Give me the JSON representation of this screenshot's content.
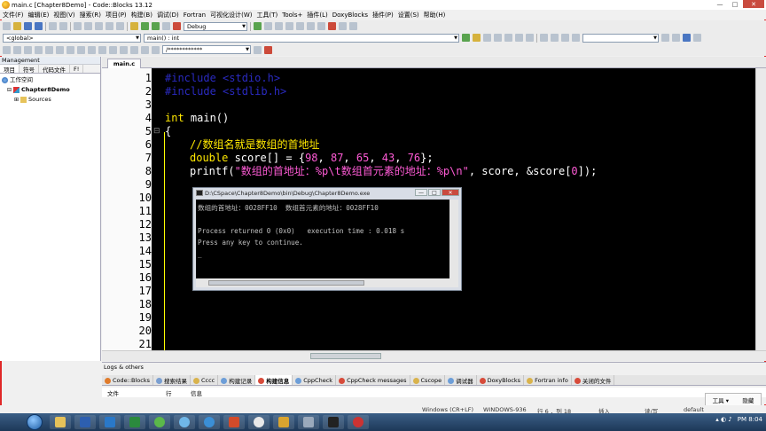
{
  "window": {
    "title": "main.c [Chapter8Demo] - Code::Blocks 13.12"
  },
  "menu": [
    "文件(F)",
    "编辑(E)",
    "视图(V)",
    "搜索(R)",
    "项目(P)",
    "构建(B)",
    "调试(D)",
    "Fortran",
    "可视化设计(W)",
    "工具(T)",
    "Tools+",
    "插件(L)",
    "DoxyBlocks",
    "插件(P)",
    "设置(S)",
    "帮助(H)"
  ],
  "toolbar": {
    "build_target": "Debug",
    "scope": "<global>",
    "function": "main() : int",
    "search_text": "/************"
  },
  "management": {
    "title": "Management",
    "tabs": [
      "项目",
      "符号",
      "代码文件",
      "F!"
    ],
    "workspace": "工作空间",
    "project": "Chapter8Demo",
    "folder": "Sources"
  },
  "editor": {
    "tab": "main.c",
    "line_numbers": [
      "1",
      "2",
      "3",
      "4",
      "5",
      "6",
      "7",
      "8",
      "9",
      "10",
      "11",
      "12",
      "13",
      "14",
      "15",
      "16",
      "17",
      "18",
      "19",
      "20",
      "21"
    ],
    "code": {
      "l1": "#include <stdio.h>",
      "l2": "#include <stdlib.h>",
      "l4_kw": "int",
      "l4_rest": " main()",
      "l5": "{",
      "l6": "//数组名就是数组的首地址",
      "l7_kw": "double",
      "l7_a": " score[] = {",
      "l7_n1": "98",
      "l7_n2": "87",
      "l7_n3": "65",
      "l7_n4": "43",
      "l7_n5": "76",
      "l7_end": "};",
      "l8_a": "printf(",
      "l8_str": "\"数组的首地址：%p\\t数组首元素的地址：%p\\n\"",
      "l8_b": ", score, &score[",
      "l8_n": "0",
      "l8_end": "]);"
    }
  },
  "console": {
    "title": "D:\\CSpace\\Chapter8Demo\\bin\\Debug\\Chapter8Demo.exe",
    "line1": "数组的首地址：0028FF10  数组首元素的地址：0028FF10",
    "line2": "Process returned 0 (0x0)   execution time : 0.018 s",
    "line3": "Press any key to continue.",
    "cursor": "_"
  },
  "logs": {
    "title": "Logs & others",
    "tabs": [
      "Code::Blocks",
      "搜索结果",
      "Cccc",
      "构建记录",
      "构建信息",
      "CppCheck",
      "CppCheck messages",
      "Cscope",
      "调试器",
      "DoxyBlocks",
      "Fortran info",
      "关闭的文件"
    ],
    "columns": [
      "文件",
      "行",
      "信息"
    ]
  },
  "popup": {
    "tools": "工具",
    "down": "▾",
    "close": "隐藏"
  },
  "status": {
    "eol": "Windows (CR+LF)",
    "encoding": "WINDOWS-936",
    "position": "行 6 ，列 18",
    "mode": "插入",
    "rw": "读/写",
    "profile": "default"
  },
  "taskbar": {
    "time": "PM 8:04"
  }
}
